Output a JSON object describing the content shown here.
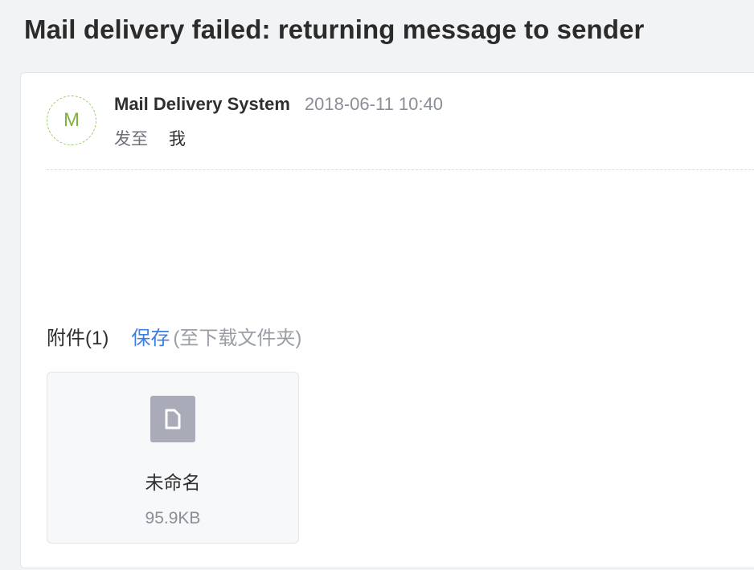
{
  "message": {
    "subject": "Mail delivery failed: returning message to sender",
    "avatar_letter": "M",
    "sender_name": "Mail Delivery System",
    "sent_time": "2018-06-11 10:40",
    "to_label": "发至",
    "to_value": "我"
  },
  "attachments": {
    "title": "附件(1)",
    "save_label": "保存",
    "save_hint": "(至下载文件夹)",
    "items": [
      {
        "name": "未命名",
        "size": "95.9KB",
        "icon": "file-icon"
      }
    ]
  },
  "colors": {
    "accent_link": "#3d7fe0",
    "avatar_green": "#7cb342",
    "file_icon_gray": "#a9acb8"
  }
}
